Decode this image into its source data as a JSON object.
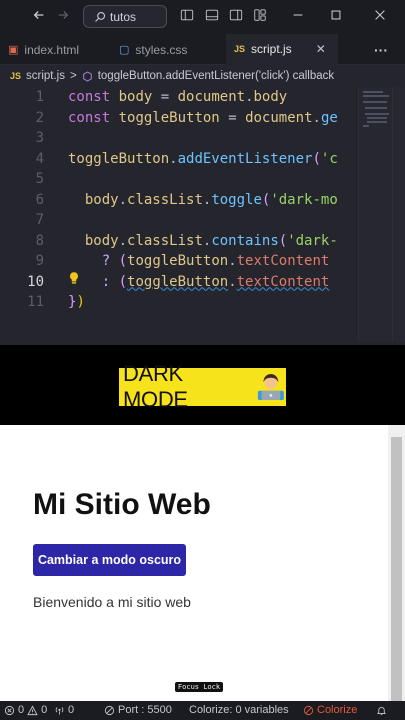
{
  "titlebar": {
    "search_text": "tutos",
    "icons": [
      "back-arrow-icon",
      "forward-arrow-icon",
      "search-icon",
      "toggle-sidebar-icon",
      "toggle-panel-icon",
      "toggle-secondary-sidebar-icon",
      "customize-layout-icon",
      "minimize-icon",
      "maximize-icon",
      "close-icon"
    ]
  },
  "tabs": [
    {
      "label": "index.html",
      "icon": "html-file-icon",
      "active": false
    },
    {
      "label": "styles.css",
      "icon": "css-file-icon",
      "active": false
    },
    {
      "label": "script.js",
      "icon": "js-file-icon",
      "active": true
    }
  ],
  "tab_actions": {
    "more_label": "···"
  },
  "breadcrumb": {
    "file_badge": "JS",
    "file": "script.js",
    "separator": ">",
    "symbol": "toggleButton.addEventListener('click') callback"
  },
  "editor": {
    "current_line": 10,
    "line_numbers": [
      "1",
      "2",
      "3",
      "4",
      "5",
      "6",
      "7",
      "8",
      "9",
      "10",
      "11"
    ],
    "lines": [
      "const body = document.body",
      "const toggleButton = document.ge",
      "",
      "toggleButton.addEventListener('c",
      "",
      "  body.classList.toggle('dark-mo",
      "",
      "  body.classList.contains('dark-",
      "    ? (toggleButton.textContent",
      "    : (toggleButton.textContent",
      "})"
    ]
  },
  "caption": {
    "text": "DARK MODE",
    "emoji": "technologist-emoji"
  },
  "preview": {
    "title": "Mi Sitio Web",
    "button_label": "Cambiar a modo oscuro",
    "welcome_text": "Bienvenido a mi sitio web",
    "overlay_label": "Focus Lock",
    "button_color": "#2d26a6"
  },
  "statusbar": {
    "errors": "0",
    "warnings": "0",
    "ports_count": "0",
    "port": "Port : 5500",
    "colorize_variables": "Colorize: 0 variables",
    "colorize": "Colorize"
  },
  "colors": {
    "editor_bg": "#24252d",
    "keyword": "#c678dd",
    "function": "#6ec3ff",
    "string": "#9ad36a",
    "caption_bg": "#f7e31c",
    "colorize_accent": "#e25a3a"
  }
}
